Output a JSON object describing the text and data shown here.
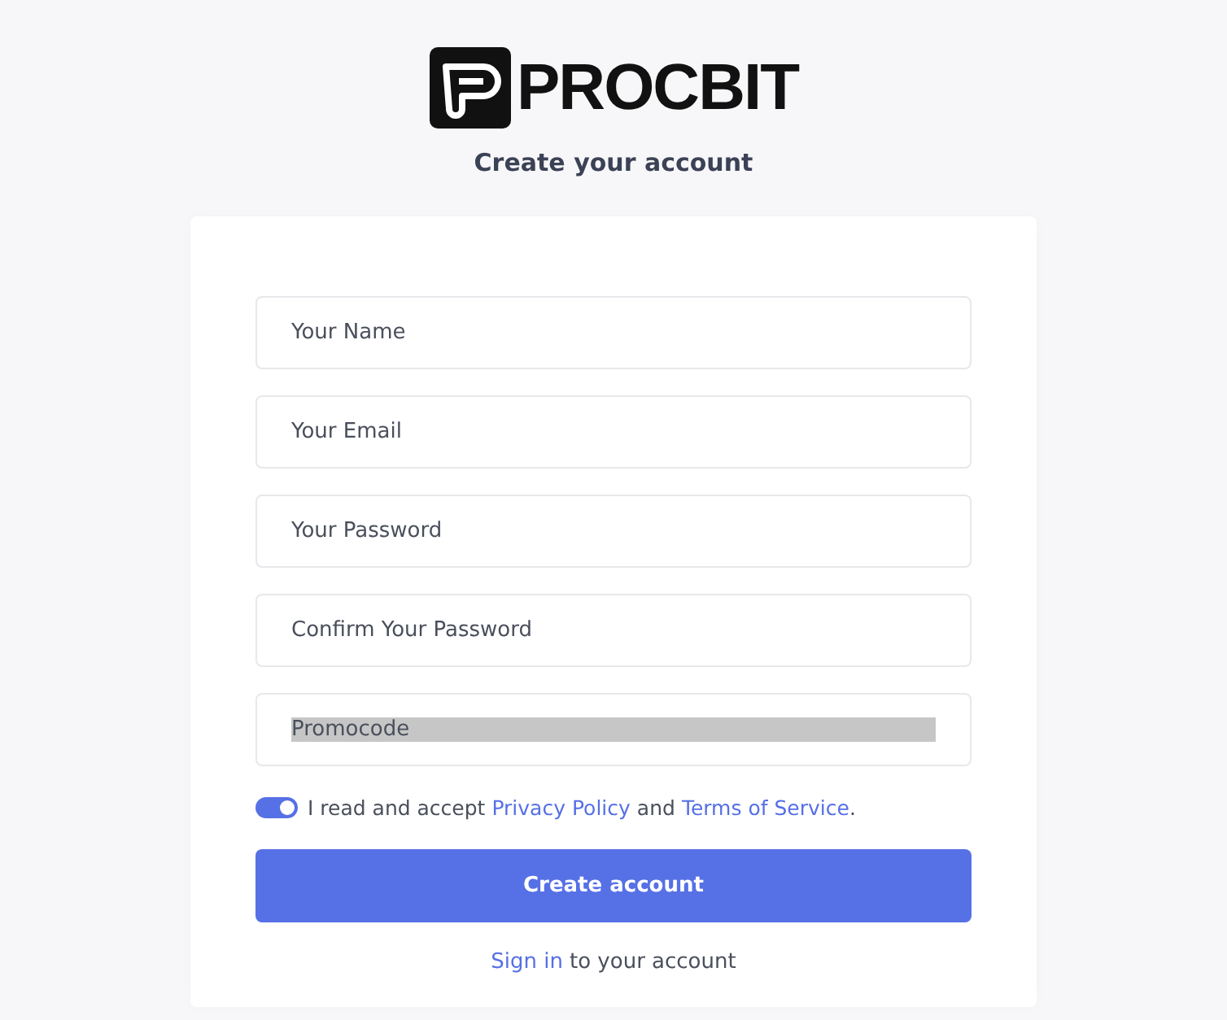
{
  "logo": {
    "text": "PROCBIT"
  },
  "title": "Create your account",
  "fields": [
    {
      "placeholder": "Your Name",
      "highlighted": false
    },
    {
      "placeholder": "Your Email",
      "highlighted": false
    },
    {
      "placeholder": "Your Password",
      "highlighted": false
    },
    {
      "placeholder": "Confirm Your Password",
      "highlighted": false
    },
    {
      "placeholder": "Promocode",
      "highlighted": true
    }
  ],
  "terms": {
    "checked": true,
    "parts": [
      {
        "kind": "text",
        "text": "I read and accept"
      },
      {
        "kind": "link",
        "text": "Privacy Policy"
      },
      {
        "kind": "text",
        "text": "and"
      },
      {
        "kind": "link",
        "text": "Terms of Service"
      },
      {
        "kind": "text",
        "text": "."
      }
    ]
  },
  "submit": "Create account",
  "signin": {
    "link": "Sign in",
    "text": "to your account"
  }
}
